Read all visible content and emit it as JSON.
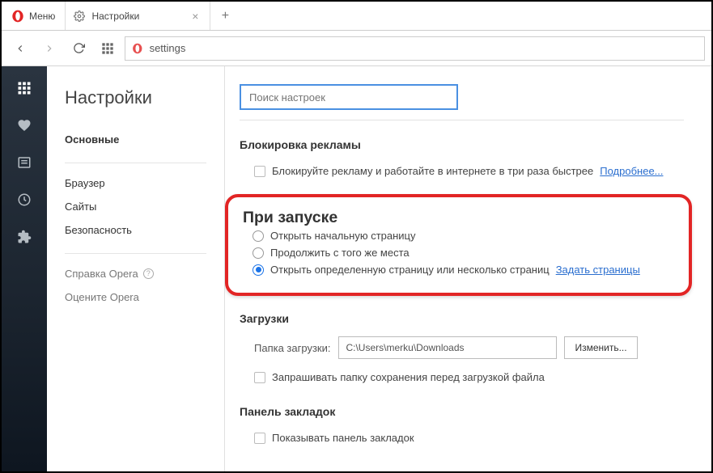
{
  "titlebar": {
    "menu_label": "Меню",
    "tab_title": "Настройки"
  },
  "addressbar": {
    "url": "settings"
  },
  "sidebar": {
    "title": "Настройки",
    "items": {
      "main": "Основные",
      "browser": "Браузер",
      "sites": "Сайты",
      "security": "Безопасность",
      "help": "Справка Opera",
      "rate": "Оцените Opera"
    }
  },
  "settings": {
    "search_placeholder": "Поиск настроек",
    "adblock": {
      "title": "Блокировка рекламы",
      "checkbox_label": "Блокируйте рекламу и работайте в интернете в три раза быстрее",
      "learn_more": "Подробнее..."
    },
    "startup": {
      "title": "При запуске",
      "opt1": "Открыть начальную страницу",
      "opt2": "Продолжить с того же места",
      "opt3": "Открыть определенную страницу или несколько страниц",
      "set_pages": "Задать страницы"
    },
    "downloads": {
      "title": "Загрузки",
      "folder_label": "Папка загрузки:",
      "folder_value": "C:\\Users\\merku\\Downloads",
      "change_btn": "Изменить...",
      "ask_checkbox": "Запрашивать папку сохранения перед загрузкой файла"
    },
    "bookmarks": {
      "title": "Панель закладок",
      "show_checkbox": "Показывать панель закладок"
    }
  }
}
